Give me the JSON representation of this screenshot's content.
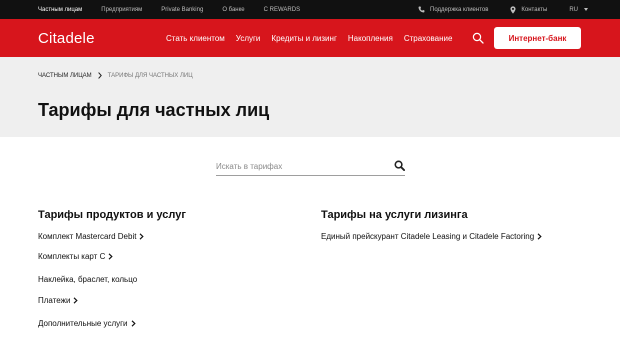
{
  "topbar": {
    "nav": [
      "Частным лицам",
      "Предприятиям",
      "Private Banking",
      "О банке",
      "C REWARDS"
    ],
    "support": "Поддержка клиентов",
    "contacts": "Контакты",
    "lang": "RU"
  },
  "mainnav": {
    "logo": "Citadele",
    "items": [
      "Стать клиентом",
      "Услуги",
      "Кредиты и лизинг",
      "Накопления",
      "Страхование"
    ],
    "ibank": "Интернет-банк"
  },
  "breadcrumb": {
    "items": [
      "ЧАСТНЫМ ЛИЦАМ",
      "ТАРИФЫ ДЛЯ ЧАСТНЫХ ЛИЦ"
    ]
  },
  "page": {
    "title": "Тарифы для частных лиц"
  },
  "search": {
    "placeholder": "Искать в тарифах"
  },
  "left": {
    "title": "Тарифы продуктов и услуг",
    "links": [
      "Комплект Mastercard Debit",
      "Комплекты карт C",
      "Наклейка, браслет, кольцо",
      "Платежи",
      "Дополнительные услуги"
    ]
  },
  "right": {
    "title": "Тарифы на услуги лизинга",
    "links": [
      "Единый прейскурант Citadele Leasing и Citadele Factoring"
    ]
  },
  "colors": {
    "brand_red": "#d7151c",
    "topbar": "#111111",
    "hero_bg": "#efefef"
  }
}
